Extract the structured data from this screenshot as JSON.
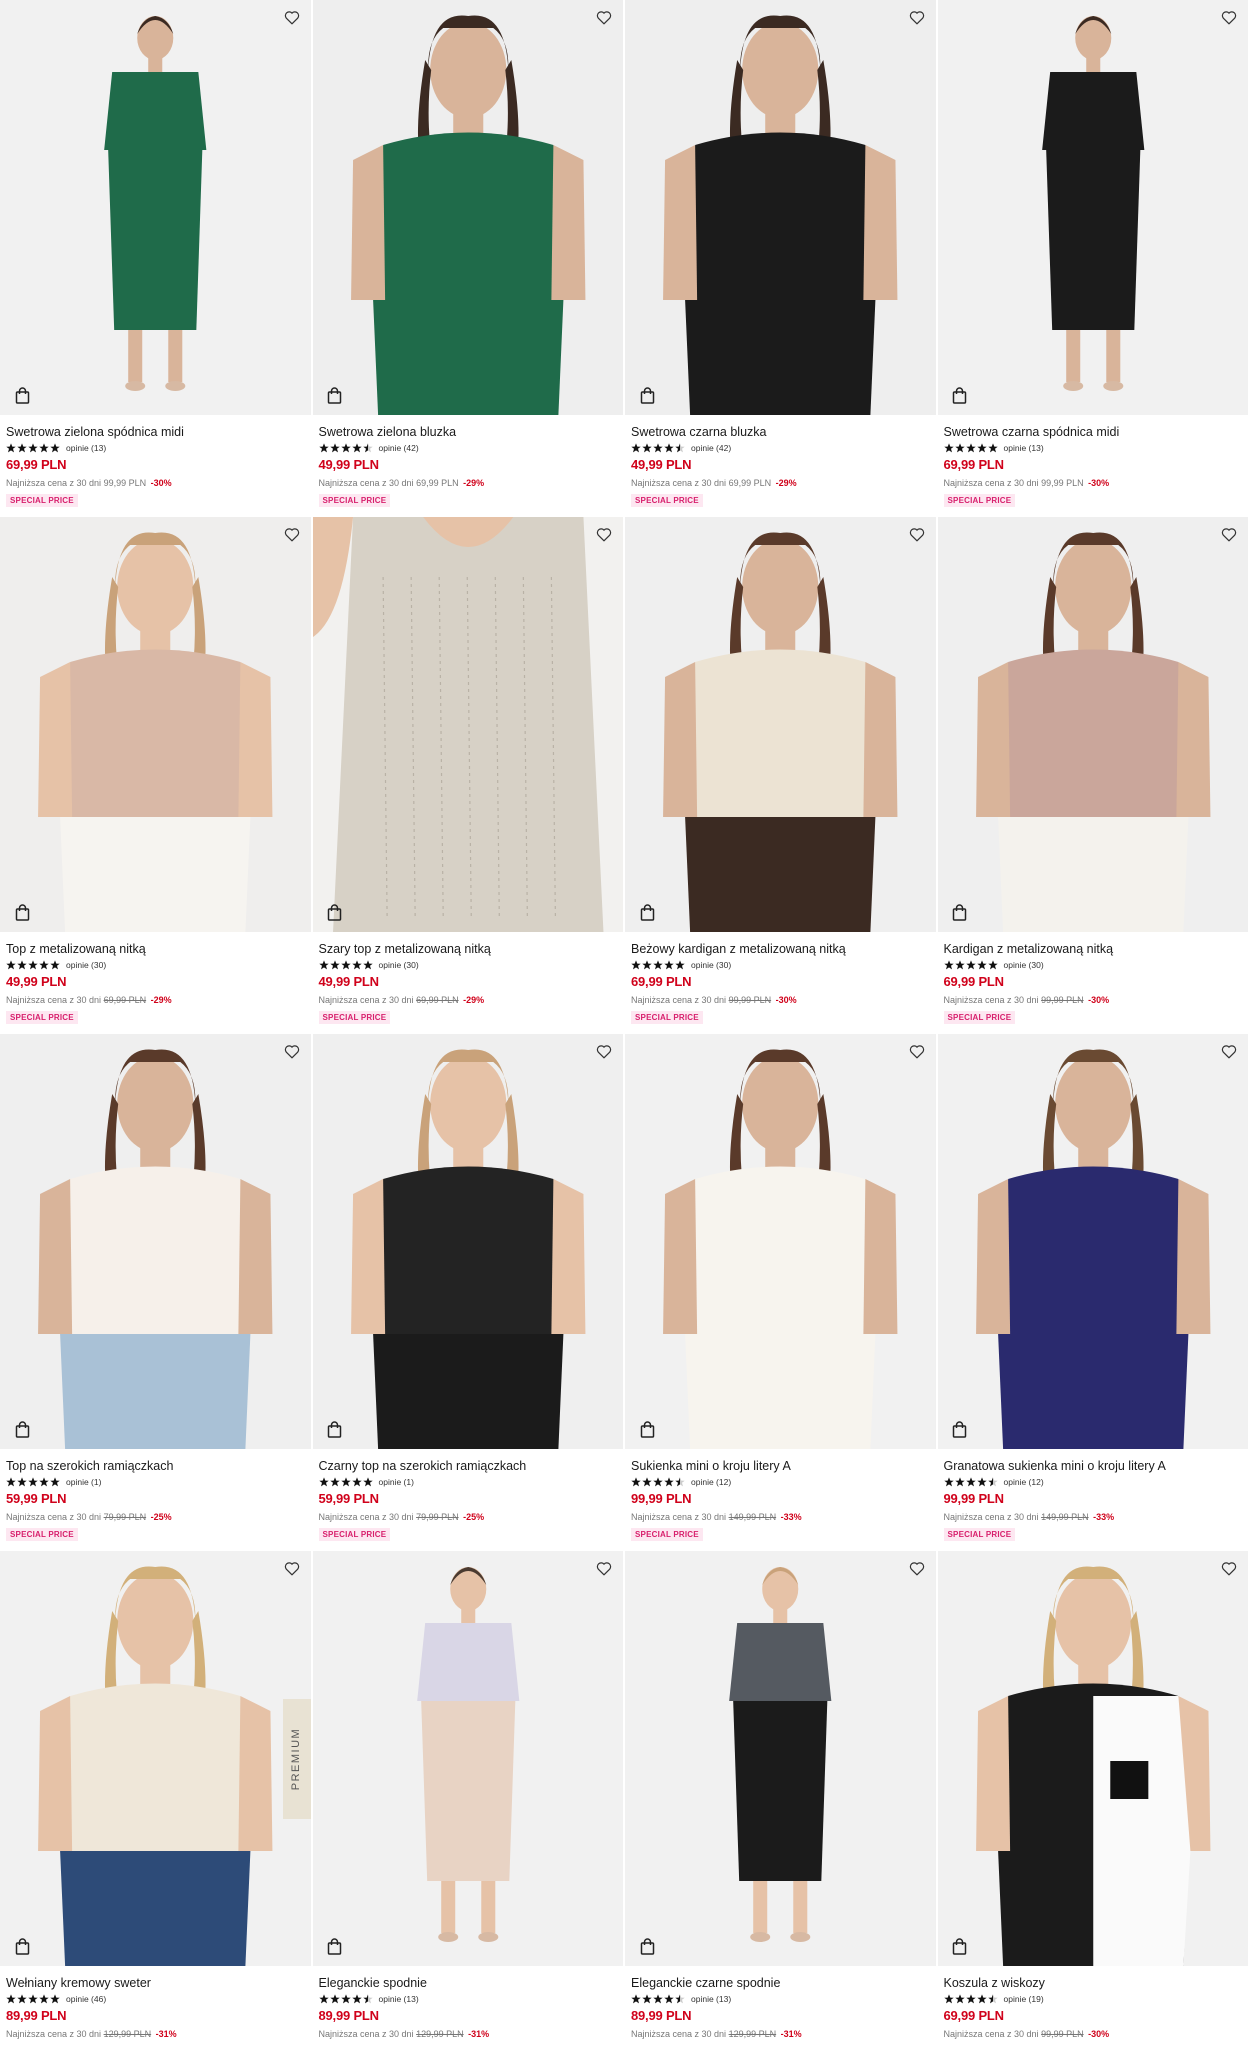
{
  "colors": {
    "price": "#d0021b",
    "badge_bg": "#fde7f1",
    "badge_text": "#d8206d"
  },
  "icons": {
    "favorite": "heart-icon",
    "cart": "shopping-bag-icon"
  },
  "products": [
    {
      "name": "Swetrowa zielona spódnica midi",
      "rating": 5,
      "reviews": "opinie (13)",
      "price": "69,99 PLN",
      "lowest_label": "Najniższa cena z 30 dni",
      "lowest_price": "99,99 PLN",
      "lowest_struck": false,
      "discount": "-30%",
      "badge": "SPECIAL PRICE"
    },
    {
      "name": "Swetrowa zielona bluzka",
      "rating": 4.5,
      "reviews": "opinie (42)",
      "price": "49,99 PLN",
      "lowest_label": "Najniższa cena z 30 dni",
      "lowest_price": "69,99 PLN",
      "lowest_struck": false,
      "discount": "-29%",
      "badge": "SPECIAL PRICE"
    },
    {
      "name": "Swetrowa czarna bluzka",
      "rating": 4.5,
      "reviews": "opinie (42)",
      "price": "49,99 PLN",
      "lowest_label": "Najniższa cena z 30 dni",
      "lowest_price": "69,99 PLN",
      "lowest_struck": false,
      "discount": "-29%",
      "badge": "SPECIAL PRICE"
    },
    {
      "name": "Swetrowa czarna spódnica midi",
      "rating": 5,
      "reviews": "opinie (13)",
      "price": "69,99 PLN",
      "lowest_label": "Najniższa cena z 30 dni",
      "lowest_price": "99,99 PLN",
      "lowest_struck": false,
      "discount": "-30%",
      "badge": "SPECIAL PRICE"
    },
    {
      "name": "Top z metalizowaną nitką",
      "rating": 5,
      "reviews": "opinie (30)",
      "price": "49,99 PLN",
      "lowest_label": "Najniższa cena z 30 dni",
      "lowest_price": "69,99 PLN",
      "lowest_struck": true,
      "discount": "-29%",
      "badge": "SPECIAL PRICE"
    },
    {
      "name": "Szary top z metalizowaną nitką",
      "rating": 5,
      "reviews": "opinie (30)",
      "price": "49,99 PLN",
      "lowest_label": "Najniższa cena z 30 dni",
      "lowest_price": "69,99 PLN",
      "lowest_struck": true,
      "discount": "-29%",
      "badge": "SPECIAL PRICE"
    },
    {
      "name": "Beżowy kardigan z metalizowaną nitką",
      "rating": 5,
      "reviews": "opinie (30)",
      "price": "69,99 PLN",
      "lowest_label": "Najniższa cena z 30 dni",
      "lowest_price": "99,99 PLN",
      "lowest_struck": true,
      "discount": "-30%",
      "badge": "SPECIAL PRICE"
    },
    {
      "name": "Kardigan z metalizowaną nitką",
      "rating": 5,
      "reviews": "opinie (30)",
      "price": "69,99 PLN",
      "lowest_label": "Najniższa cena z 30 dni",
      "lowest_price": "99,99 PLN",
      "lowest_struck": true,
      "discount": "-30%",
      "badge": "SPECIAL PRICE"
    },
    {
      "name": "Top na szerokich ramiączkach",
      "rating": 5,
      "reviews": "opinie (1)",
      "price": "59,99 PLN",
      "lowest_label": "Najniższa cena z 30 dni",
      "lowest_price": "79,99 PLN",
      "lowest_struck": true,
      "discount": "-25%",
      "badge": "SPECIAL PRICE"
    },
    {
      "name": "Czarny top na szerokich ramiączkach",
      "rating": 5,
      "reviews": "opinie (1)",
      "price": "59,99 PLN",
      "lowest_label": "Najniższa cena z 30 dni",
      "lowest_price": "79,99 PLN",
      "lowest_struck": true,
      "discount": "-25%",
      "badge": "SPECIAL PRICE"
    },
    {
      "name": "Sukienka mini o kroju litery A",
      "rating": 4.5,
      "reviews": "opinie (12)",
      "price": "99,99 PLN",
      "lowest_label": "Najniższa cena z 30 dni",
      "lowest_price": "149,99 PLN",
      "lowest_struck": true,
      "discount": "-33%",
      "badge": "SPECIAL PRICE"
    },
    {
      "name": "Granatowa sukienka mini o kroju litery A",
      "rating": 4.5,
      "reviews": "opinie (12)",
      "price": "99,99 PLN",
      "lowest_label": "Najniższa cena z 30 dni",
      "lowest_price": "149,99 PLN",
      "lowest_struck": true,
      "discount": "-33%",
      "badge": "SPECIAL PRICE"
    },
    {
      "name": "Wełniany kremowy sweter",
      "rating": 5,
      "reviews": "opinie (46)",
      "price": "89,99 PLN",
      "lowest_label": "Najniższa cena z 30 dni",
      "lowest_price": "129,99 PLN",
      "lowest_struck": true,
      "discount": "-31%",
      "badge": "",
      "premium": "PREMIUM"
    },
    {
      "name": "Eleganckie spodnie",
      "rating": 4.5,
      "reviews": "opinie (13)",
      "price": "89,99 PLN",
      "lowest_label": "Najniższa cena z 30 dni",
      "lowest_price": "129,99 PLN",
      "lowest_struck": true,
      "discount": "-31%",
      "badge": ""
    },
    {
      "name": "Eleganckie czarne spodnie",
      "rating": 4.5,
      "reviews": "opinie (13)",
      "price": "89,99 PLN",
      "lowest_label": "Najniższa cena z 30 dni",
      "lowest_price": "129,99 PLN",
      "lowest_struck": true,
      "discount": "-31%",
      "badge": ""
    },
    {
      "name": "Koszula z wiskozy",
      "rating": 4.5,
      "reviews": "opinie (19)",
      "price": "69,99 PLN",
      "lowest_label": "Najniższa cena z 30 dni",
      "lowest_price": "99,99 PLN",
      "lowest_struck": true,
      "discount": "-30%",
      "badge": ""
    }
  ]
}
